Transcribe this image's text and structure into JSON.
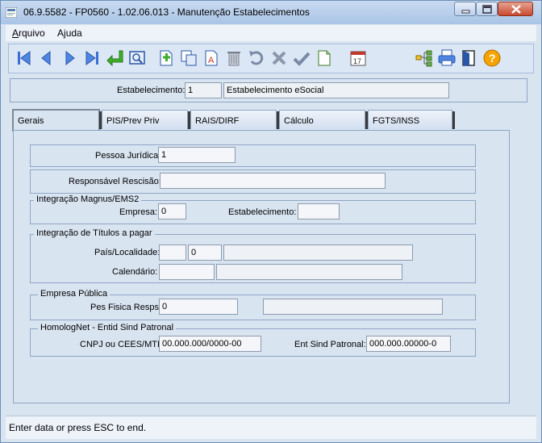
{
  "window": {
    "title": "06.9.5582 - FP0560 - 1.02.06.013 - Manutenção Estabelecimentos"
  },
  "menu": {
    "arquivo_label": "Arquivo",
    "ajuda_label": "Ajuda"
  },
  "toolbar_icons": [
    "first-record-icon",
    "previous-record-icon",
    "next-record-icon",
    "last-record-icon",
    "go-to-icon",
    "search-icon",
    "add-icon",
    "copy-icon",
    "edit-icon",
    "delete-icon",
    "undo-icon",
    "cancel-icon",
    "save-icon",
    "blank-icon",
    "calendar-icon",
    "tree-icon",
    "print-icon",
    "exit-icon",
    "help-icon"
  ],
  "header": {
    "estabelecimento_label": "Estabelecimento:",
    "estabelecimento_code": "1",
    "estabelecimento_name": "Estabelecimento eSocial"
  },
  "tabs": [
    "Gerais",
    "PIS/Prev Priv",
    "RAIS/DIRF",
    "Cálculo",
    "FGTS/INSS"
  ],
  "gerais": {
    "pessoa_juridica_label": "Pessoa Jurídica:",
    "pessoa_juridica_value": "1",
    "responsavel_label": "Responsável Rescisão:",
    "responsavel_value": "",
    "integracao_magnus_title": "Integração Magnus/EMS2",
    "empresa_label": "Empresa:",
    "empresa_value": "0",
    "estab_label": "Estabelecimento:",
    "estab_value": "",
    "integracao_titulos_title": "Integração de Títulos a pagar",
    "pais_label": "País/Localidade:",
    "pais_value": "",
    "localidade_code": "0",
    "localidade_name": "",
    "calendario_label": "Calendário:",
    "calendario_value": "",
    "calendario_desc": "",
    "empresa_publica_title": "Empresa Pública",
    "pes_fisica_label": "Pes Fisica Resps:",
    "pes_fisica_value": "0",
    "pes_fisica_name": "",
    "homolognet_title": "HomologNet - Entid Sind Patronal",
    "cnpj_label": "CNPJ ou CEES/MTE:",
    "cnpj_value": "00.000.000/0000-00",
    "ent_sind_label": "Ent Sind Patronal:",
    "ent_sind_value": "000.000.00000-0"
  },
  "status": {
    "message": "Enter data or press ESC to end."
  }
}
